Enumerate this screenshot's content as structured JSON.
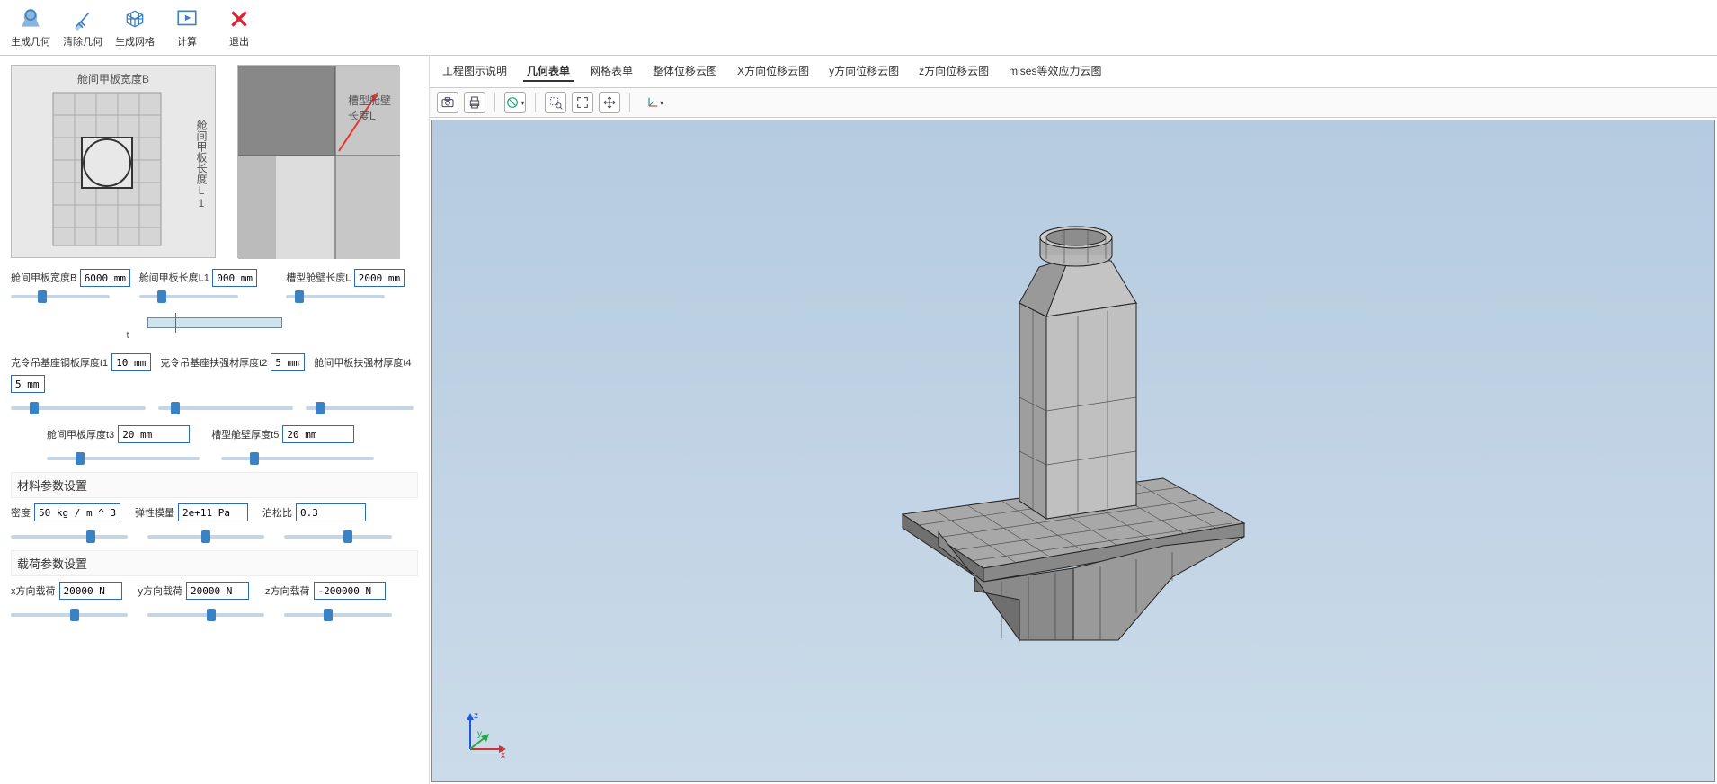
{
  "toolbar": {
    "generate_geo": "生成几何",
    "clear_geo": "清除几何",
    "generate_mesh": "生成网格",
    "calculate": "计算",
    "exit": "退出"
  },
  "diagrams": {
    "d1_top": "舱间甲板宽度B",
    "d1_right": "舱间甲板长度L1",
    "d2_label": "槽型舱壁长度L"
  },
  "params": {
    "B_label": "舱间甲板宽度B",
    "B_value": "6000 mm",
    "L1_label": "舱间甲板长度L1",
    "L1_value": "000 mm",
    "L_label": "槽型舱壁长度L",
    "L_value": "2000 mm",
    "t_sym": "t",
    "t1_label": "克令吊基座钢板厚度t1",
    "t1_value": "10 mm",
    "t2_label": "克令吊基座扶强材厚度t2",
    "t2_value": "5 mm",
    "t4_label": "舱间甲板扶强材厚度t4",
    "t4_value": "5 mm",
    "t3_label": "舱间甲板厚度t3",
    "t3_value": "20 mm",
    "t5_label": "槽型舱壁厚度t5",
    "t5_value": "20 mm"
  },
  "material": {
    "section": "材料参数设置",
    "density_label": "密度",
    "density_value": "50 kg / m ^ 3",
    "elastic_label": "弹性模量",
    "elastic_value": "2e+11 Pa",
    "poisson_label": "泊松比",
    "poisson_value": "0.3"
  },
  "load": {
    "section": "载荷参数设置",
    "fx_label": "x方向载荷",
    "fx_value": "20000 N",
    "fy_label": "y方向载荷",
    "fy_value": "20000 N",
    "fz_label": "z方向载荷",
    "fz_value": "-200000 N"
  },
  "tabs": {
    "t0": "工程图示说明",
    "t1": "几何表单",
    "t2": "网格表单",
    "t3": "整体位移云图",
    "t4": "X方向位移云图",
    "t5": "y方向位移云图",
    "t6": "z方向位移云图",
    "t7": "mises等效应力云图"
  },
  "axis": {
    "x": "x",
    "y": "y",
    "z": "z"
  }
}
